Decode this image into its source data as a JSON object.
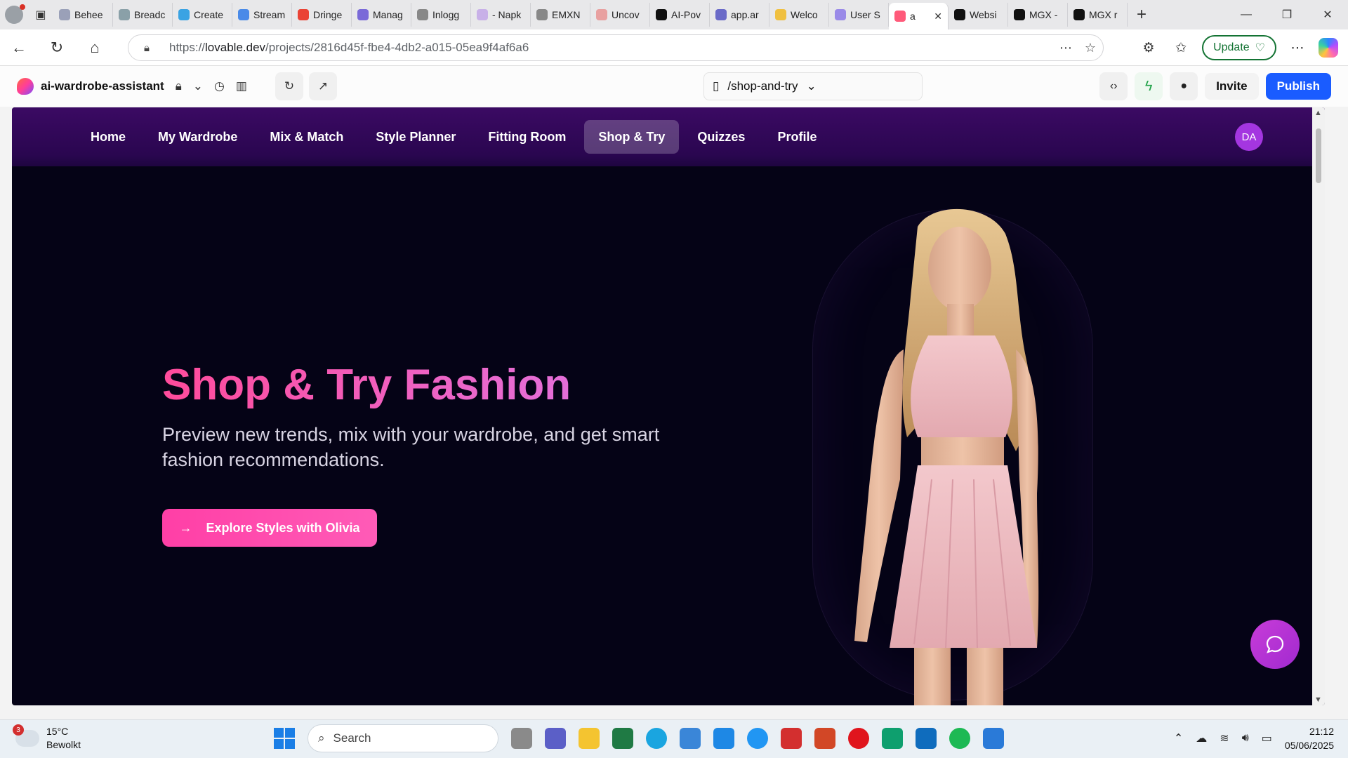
{
  "browser": {
    "tabs": [
      {
        "label": "Behee",
        "favicon": "#9aa0b8"
      },
      {
        "label": "Breadc",
        "favicon": "#8aa0a8"
      },
      {
        "label": "Create",
        "favicon": "#3aa3e3"
      },
      {
        "label": "Stream",
        "favicon": "#4a8ae8"
      },
      {
        "label": "Dringe",
        "favicon": "#ea4335"
      },
      {
        "label": "Manag",
        "favicon": "#7a6ad8"
      },
      {
        "label": "Inlogg",
        "favicon": "#888888"
      },
      {
        "label": "- Napk",
        "favicon": "#c8b0e8"
      },
      {
        "label": "EMXN",
        "favicon": "#888888"
      },
      {
        "label": "Uncov",
        "favicon": "#e8a0a0"
      },
      {
        "label": "AI-Pov",
        "favicon": "#111111"
      },
      {
        "label": "app.ar",
        "favicon": "#6a6ac8"
      },
      {
        "label": "Welco",
        "favicon": "#f0c040"
      },
      {
        "label": "User S",
        "favicon": "#9a8ae8"
      },
      {
        "label": "a",
        "favicon": "#ff5a7a",
        "active": true
      },
      {
        "label": "Websi",
        "favicon": "#111111"
      },
      {
        "label": "MGX -",
        "favicon": "#111111"
      },
      {
        "label": "MGX r",
        "favicon": "#111111"
      }
    ],
    "url_prefix": "https://",
    "url_host": "lovable.dev",
    "url_path": "/projects/2816d45f-fbe4-4db2-a015-05ea9f4af6a6",
    "update_label": "Update"
  },
  "lovable": {
    "project_name": "ai-wardrobe-assistant",
    "route": "/shop-and-try",
    "invite_label": "Invite",
    "publish_label": "Publish"
  },
  "app": {
    "nav": [
      {
        "label": "Home",
        "active": false
      },
      {
        "label": "My Wardrobe",
        "active": false
      },
      {
        "label": "Mix & Match",
        "active": false
      },
      {
        "label": "Style Planner",
        "active": false
      },
      {
        "label": "Fitting Room",
        "active": false
      },
      {
        "label": "Shop & Try",
        "active": true
      },
      {
        "label": "Quizzes",
        "active": false
      },
      {
        "label": "Profile",
        "active": false
      }
    ],
    "user_initials": "DA",
    "hero_title": "Shop & Try Fashion",
    "hero_subtitle": "Preview new trends, mix with your wardrobe, and get smart fashion recommendations.",
    "cta_label": "Explore Styles with Olivia"
  },
  "taskbar": {
    "weather_badge": "3",
    "temperature": "15°C",
    "condition": "Bewolkt",
    "search_placeholder": "Search",
    "time": "21:12",
    "date": "05/06/2025"
  },
  "colors": {
    "accent_pink": "#ff4b9b",
    "nav_purple": "#2a0650",
    "publish_blue": "#1a5cff"
  }
}
